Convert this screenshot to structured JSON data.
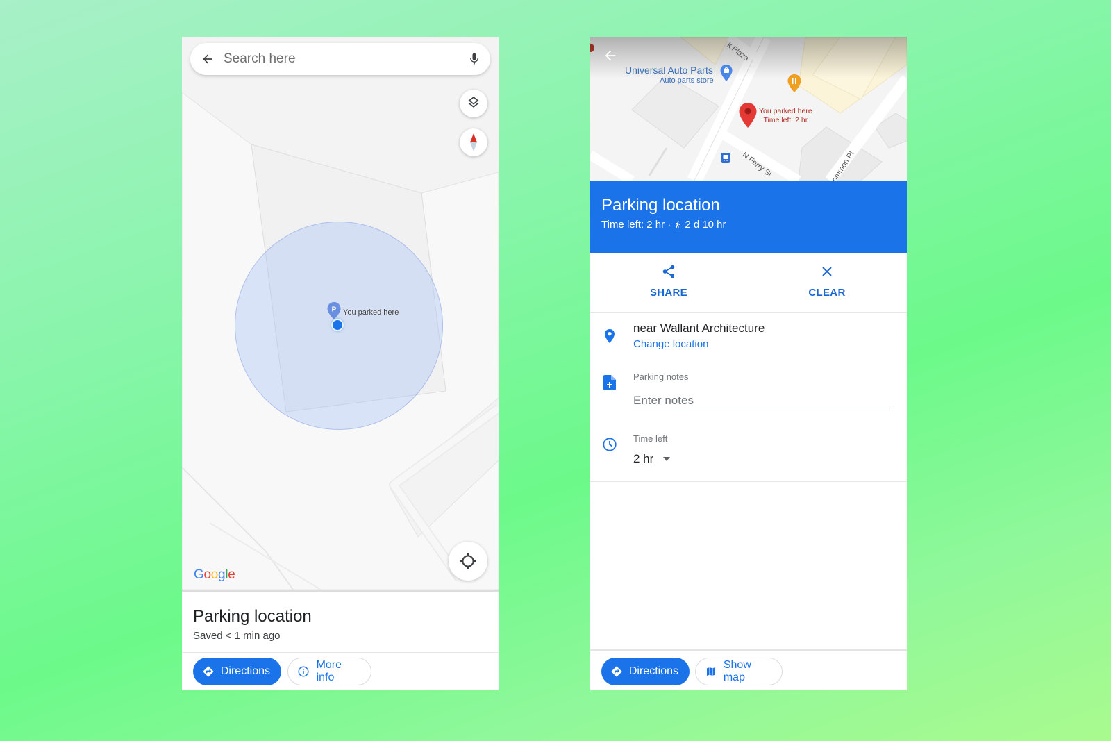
{
  "left": {
    "search": {
      "placeholder": "Search here"
    },
    "map": {
      "marker_label": "You parked here",
      "marker_letter": "P",
      "attribution": [
        "G",
        "o",
        "o",
        "g",
        "l",
        "e"
      ],
      "attribution_colors": [
        "#4285f4",
        "#ea4335",
        "#fbbc05",
        "#4285f4",
        "#34a853",
        "#ea4335"
      ]
    },
    "sheet": {
      "title": "Parking location",
      "subtitle": "Saved < 1 min ago"
    },
    "buttons": {
      "directions": "Directions",
      "more_info": "More info"
    },
    "icons": {
      "back": "arrow-left-icon",
      "mic": "microphone-icon",
      "layers": "layers-icon",
      "compass": "compass-icon",
      "locate": "my-location-icon",
      "directions": "directions-diamond-icon",
      "info": "info-icon"
    }
  },
  "right": {
    "map": {
      "poi_name": "Universal Auto Parts",
      "poi_category": "Auto parts store",
      "marker_label_line1": "You parked here",
      "marker_label_line2": "Time left: 2 hr",
      "streets": [
        "k Plaza",
        "N Ferry St",
        "ommon Pl"
      ]
    },
    "header": {
      "title": "Parking location",
      "time_left": "Time left: 2 hr ·",
      "walk_time": "2 d 10 hr"
    },
    "actions": {
      "share": "SHARE",
      "clear": "CLEAR"
    },
    "location": {
      "name": "near Wallant Architecture",
      "change_link": "Change location"
    },
    "notes": {
      "label": "Parking notes",
      "placeholder": "Enter notes",
      "value": ""
    },
    "time_left": {
      "label": "Time left",
      "selected": "2 hr"
    },
    "buttons": {
      "directions": "Directions",
      "show_map": "Show map"
    }
  },
  "colors": {
    "accent": "#1a73e8",
    "parked_marker_red": "#e53935",
    "link": "#1a73e8"
  }
}
